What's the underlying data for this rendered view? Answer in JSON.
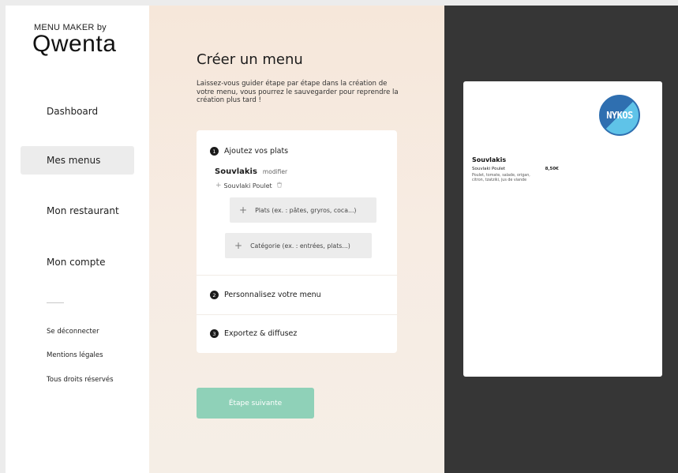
{
  "brand": {
    "small": "MENU MAKER by",
    "big": "Qwenta"
  },
  "sidebar": {
    "items": [
      {
        "label": "Dashboard",
        "active": false
      },
      {
        "label": "Mes menus",
        "active": true
      },
      {
        "label": "Mon restaurant",
        "active": false
      },
      {
        "label": "Mon compte",
        "active": false
      }
    ],
    "footer": [
      "Se déconnecter",
      "Mentions légales",
      "Tous droits réservés"
    ]
  },
  "main": {
    "title": "Créer un menu",
    "description": "Laissez-vous guider étape par étape dans la création de votre menu, vous pourrez le sauvegarder pour reprendre la création plus tard !",
    "steps": [
      {
        "num": "1",
        "label": "Ajoutez vos plats"
      },
      {
        "num": "2",
        "label": "Personnalisez votre menu"
      },
      {
        "num": "3",
        "label": "Exportez & diffusez"
      }
    ],
    "category": {
      "name": "Souvlakis",
      "edit_label": "modifier"
    },
    "dish": {
      "name": "Souvlaki Poulet"
    },
    "add_dish_placeholder": "Plats (ex. : pâtes, gryros, coca...)",
    "add_category_placeholder": "Catégorie (ex. : entrées, plats...)",
    "next_button": "Étape suivante"
  },
  "preview": {
    "logo_text": "NYKOS",
    "category": "Souvlakis",
    "dish_name": "Souvlaki Poulet",
    "dish_price": "8,50€",
    "dish_description": "Poulet, tomate, salade, origan, citron, tzatziki, jus de viande"
  },
  "colors": {
    "accent_button": "#8fd1b8",
    "preview_background": "#363636",
    "center_background": "#f6e7da",
    "logo_blue": "#2f6fb0",
    "logo_light_blue": "#5fc3e8"
  },
  "icons": {
    "plus": "plus-icon",
    "trash": "trash-icon"
  }
}
